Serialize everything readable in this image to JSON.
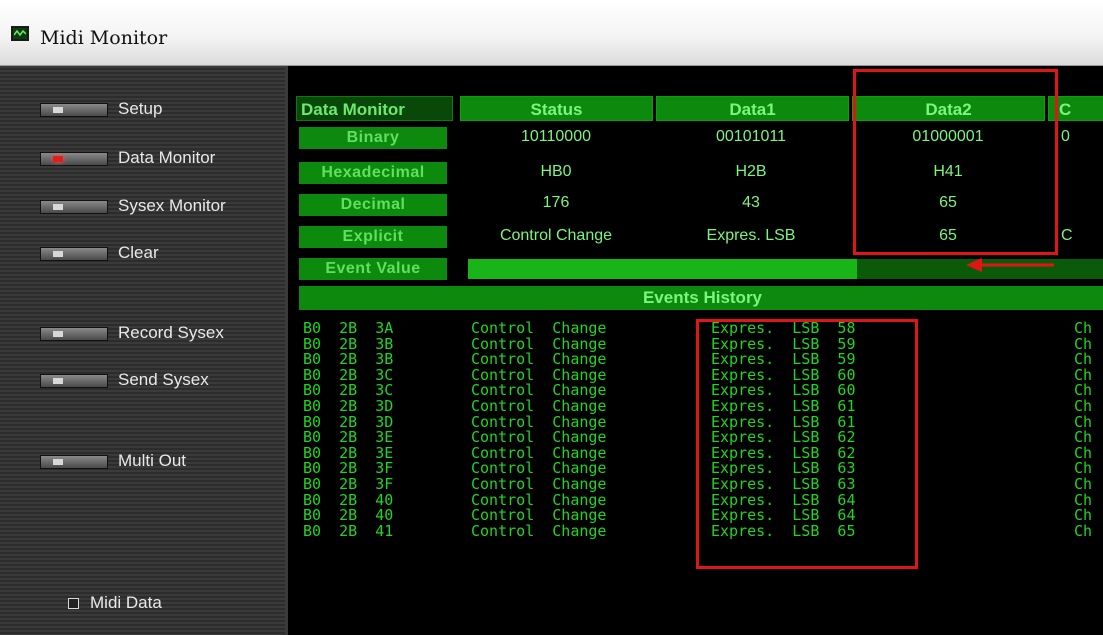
{
  "window": {
    "title": "Midi Monitor"
  },
  "sidebar": {
    "buttons": [
      {
        "label": "Setup",
        "active": false
      },
      {
        "label": "Data Monitor",
        "active": true
      },
      {
        "label": "Sysex Monitor",
        "active": false
      },
      {
        "label": "Clear",
        "active": false
      },
      {
        "label": "Record Sysex",
        "active": false
      },
      {
        "label": "Send Sysex",
        "active": false
      },
      {
        "label": "Multi Out",
        "active": false
      }
    ],
    "midi_data_checkbox": {
      "label": "Midi Data",
      "checked": false
    }
  },
  "monitor": {
    "title": "Data Monitor",
    "columns": [
      "Status",
      "Data1",
      "Data2",
      "C"
    ],
    "rows": [
      {
        "label": "Binary",
        "values": [
          "10110000",
          "00101011",
          "01000001",
          "0"
        ]
      },
      {
        "label": "Hexadecimal",
        "values": [
          "HB0",
          "H2B",
          "H41",
          ""
        ]
      },
      {
        "label": "Decimal",
        "values": [
          "176",
          "43",
          "65",
          ""
        ]
      },
      {
        "label": "Explicit",
        "values": [
          "Control Change",
          "Expres. LSB",
          "65",
          "C"
        ]
      }
    ],
    "event_value": {
      "label": "Event Value",
      "level": 0.61
    }
  },
  "history": {
    "title": "Events History",
    "rows": [
      {
        "raw": "B0  2B  3A",
        "type": "Control  Change",
        "desc": "Expres.  LSB  58",
        "ch": "Ch"
      },
      {
        "raw": "B0  2B  3B",
        "type": "Control  Change",
        "desc": "Expres.  LSB  59",
        "ch": "Ch"
      },
      {
        "raw": "B0  2B  3B",
        "type": "Control  Change",
        "desc": "Expres.  LSB  59",
        "ch": "Ch"
      },
      {
        "raw": "B0  2B  3C",
        "type": "Control  Change",
        "desc": "Expres.  LSB  60",
        "ch": "Ch"
      },
      {
        "raw": "B0  2B  3C",
        "type": "Control  Change",
        "desc": "Expres.  LSB  60",
        "ch": "Ch"
      },
      {
        "raw": "B0  2B  3D",
        "type": "Control  Change",
        "desc": "Expres.  LSB  61",
        "ch": "Ch"
      },
      {
        "raw": "B0  2B  3D",
        "type": "Control  Change",
        "desc": "Expres.  LSB  61",
        "ch": "Ch"
      },
      {
        "raw": "B0  2B  3E",
        "type": "Control  Change",
        "desc": "Expres.  LSB  62",
        "ch": "Ch"
      },
      {
        "raw": "B0  2B  3E",
        "type": "Control  Change",
        "desc": "Expres.  LSB  62",
        "ch": "Ch"
      },
      {
        "raw": "B0  2B  3F",
        "type": "Control  Change",
        "desc": "Expres.  LSB  63",
        "ch": "Ch"
      },
      {
        "raw": "B0  2B  3F",
        "type": "Control  Change",
        "desc": "Expres.  LSB  63",
        "ch": "Ch"
      },
      {
        "raw": "B0  2B  40",
        "type": "Control  Change",
        "desc": "Expres.  LSB  64",
        "ch": "Ch"
      },
      {
        "raw": "B0  2B  40",
        "type": "Control  Change",
        "desc": "Expres.  LSB  64",
        "ch": "Ch"
      },
      {
        "raw": "B0  2B  41",
        "type": "Control  Change",
        "desc": "Expres.  LSB  65",
        "ch": "Ch"
      }
    ]
  },
  "colors": {
    "accent_green": "#0d8a0d",
    "text_green": "#7cf57c",
    "highlight_red": "#e01616"
  }
}
